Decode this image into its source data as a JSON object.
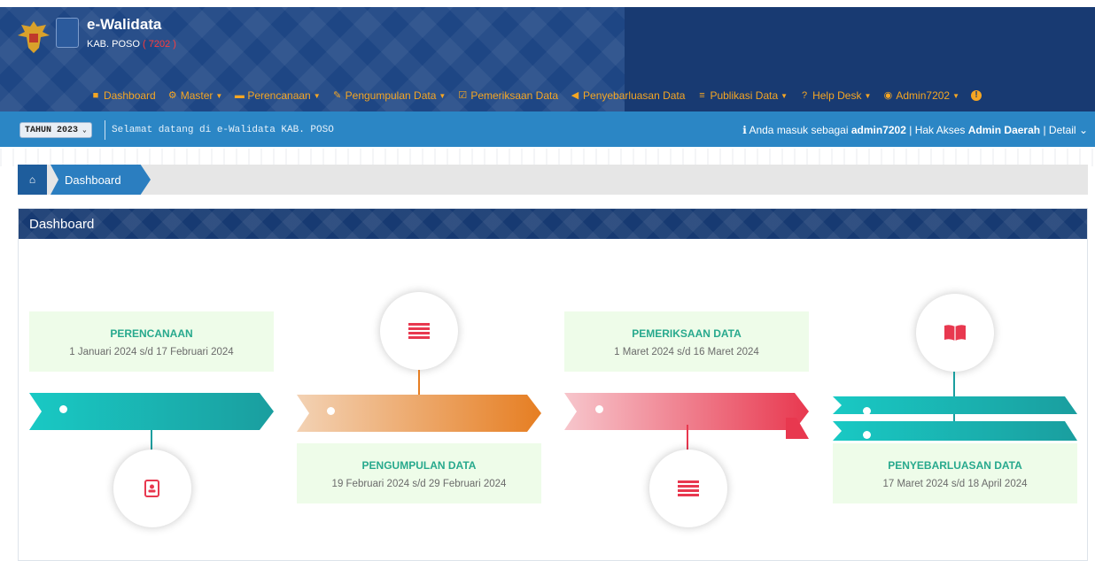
{
  "header": {
    "brand": "e-Walidata",
    "region": "KAB. POSO",
    "region_code": "( 7202 )"
  },
  "nav": {
    "dashboard": "Dashboard",
    "master": "Master",
    "perencanaan": "Perencanaan",
    "pengumpulan": "Pengumpulan Data",
    "pemeriksaan": "Pemeriksaan Data",
    "penyebarluasan": "Penyebarluasan Data",
    "publikasi": "Publikasi Data",
    "helpdesk": "Help Desk",
    "user": "Admin7202"
  },
  "infobar": {
    "year": "TAHUN 2023",
    "welcome": "Selamat datang di e-Walidata KAB. POSO",
    "login_prefix": "Anda masuk sebagai",
    "username": "admin7202",
    "access_prefix": "| Hak Akses",
    "role": "Admin Daerah",
    "detail": "| Detail"
  },
  "breadcrumb": {
    "current": "Dashboard"
  },
  "panel": {
    "title": "Dashboard"
  },
  "timeline": [
    {
      "title": "PERENCANAAN",
      "period": "1 Januari 2024 s/d 17 Februari 2024"
    },
    {
      "title": "PENGUMPULAN DATA",
      "period": "19 Februari 2024 s/d 29 Februari 2024"
    },
    {
      "title": "PEMERIKSAAN DATA",
      "period": "1 Maret 2024 s/d 16 Maret 2024"
    },
    {
      "title": "PENYEBARLUASAN DATA",
      "period": "17 Maret 2024 s/d 18 April 2024"
    }
  ],
  "colors": {
    "header": "#183a72",
    "nav_text": "#f5a623",
    "infobar": "#2b86c5",
    "teal": "#27a98d",
    "orange": "#e67e22",
    "red": "#e8384f",
    "icon_red": "#e8384f"
  }
}
